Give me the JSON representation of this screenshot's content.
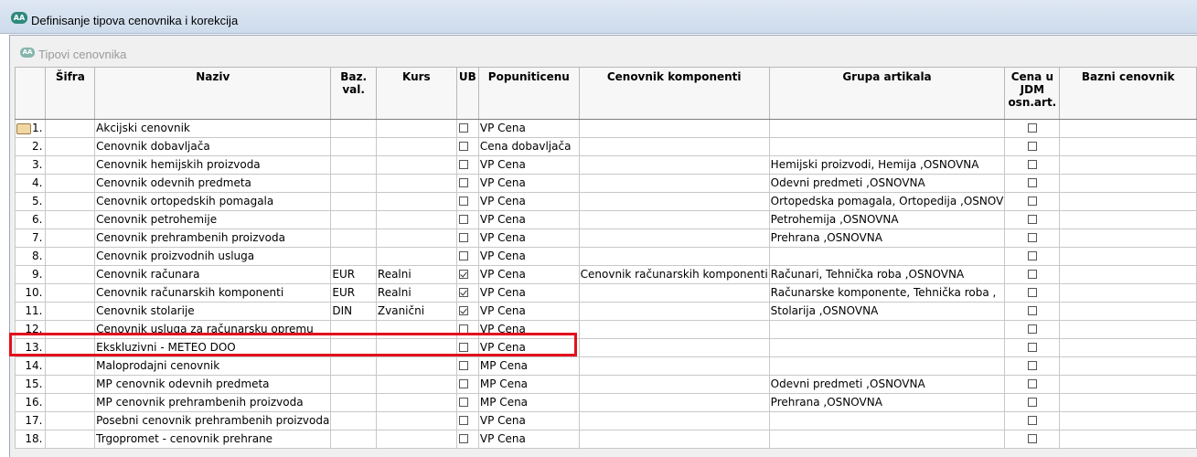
{
  "window": {
    "title": "Definisanje tipova cenovnika i korekcija",
    "icon": "app-logo-icon"
  },
  "panel": {
    "title": "Tipovi cenovnika"
  },
  "columns": {
    "sifra": "Šifra",
    "naziv": "Naziv",
    "bazval": "Baz. val.",
    "kurs": "Kurs",
    "ub": "UB",
    "popuniti": "Popuniticenu",
    "komponenti": "Cenovnik komponenti",
    "grupa": "Grupa artikala",
    "cena_jdm": "Cena u JDM osn.art.",
    "bazni": "Bazni cenovnik"
  },
  "rows": [
    {
      "num": "1.",
      "sifra": "",
      "naziv": "Akcijski cenovnik",
      "bazval": "",
      "kurs": "",
      "ub": false,
      "popuniti": "VP Cena",
      "komponenti": "",
      "grupa": "",
      "cena_jdm": false,
      "bazni": ""
    },
    {
      "num": "2.",
      "sifra": "",
      "naziv": "Cenovnik dobavljača",
      "bazval": "",
      "kurs": "",
      "ub": false,
      "popuniti": "Cena dobavljača",
      "komponenti": "",
      "grupa": "",
      "cena_jdm": false,
      "bazni": ""
    },
    {
      "num": "3.",
      "sifra": "",
      "naziv": "Cenovnik hemijskih proizvoda",
      "bazval": "",
      "kurs": "",
      "ub": false,
      "popuniti": "VP Cena",
      "komponenti": "",
      "grupa": "Hemijski proizvodi, Hemija ,OSNOVNA",
      "cena_jdm": false,
      "bazni": ""
    },
    {
      "num": "4.",
      "sifra": "",
      "naziv": "Cenovnik odevnih predmeta",
      "bazval": "",
      "kurs": "",
      "ub": false,
      "popuniti": "VP Cena",
      "komponenti": "",
      "grupa": "Odevni predmeti ,OSNOVNA",
      "cena_jdm": false,
      "bazni": ""
    },
    {
      "num": "5.",
      "sifra": "",
      "naziv": "Cenovnik ortopedskih pomagala",
      "bazval": "",
      "kurs": "",
      "ub": false,
      "popuniti": "VP Cena",
      "komponenti": "",
      "grupa": "Ortopedska pomagala, Ortopedija ,OSNOV",
      "cena_jdm": false,
      "bazni": ""
    },
    {
      "num": "6.",
      "sifra": "",
      "naziv": "Cenovnik petrohemije",
      "bazval": "",
      "kurs": "",
      "ub": false,
      "popuniti": "VP Cena",
      "komponenti": "",
      "grupa": "Petrohemija ,OSNOVNA",
      "cena_jdm": false,
      "bazni": ""
    },
    {
      "num": "7.",
      "sifra": "",
      "naziv": "Cenovnik prehrambenih proizvoda",
      "bazval": "",
      "kurs": "",
      "ub": false,
      "popuniti": "VP Cena",
      "komponenti": "",
      "grupa": "Prehrana ,OSNOVNA",
      "cena_jdm": false,
      "bazni": ""
    },
    {
      "num": "8.",
      "sifra": "",
      "naziv": "Cenovnik proizvodnih usluga",
      "bazval": "",
      "kurs": "",
      "ub": false,
      "popuniti": "VP Cena",
      "komponenti": "",
      "grupa": "",
      "cena_jdm": false,
      "bazni": ""
    },
    {
      "num": "9.",
      "sifra": "",
      "naziv": "Cenovnik računara",
      "bazval": "EUR",
      "kurs": "Realni",
      "ub": true,
      "popuniti": "VP Cena",
      "komponenti": "Cenovnik računarskih komponenti",
      "grupa": "Računari, Tehnička roba ,OSNOVNA",
      "cena_jdm": false,
      "bazni": ""
    },
    {
      "num": "10.",
      "sifra": "",
      "naziv": "Cenovnik računarskih komponenti",
      "bazval": "EUR",
      "kurs": "Realni",
      "ub": true,
      "popuniti": "VP Cena",
      "komponenti": "",
      "grupa": "Računarske komponente, Tehnička roba ,",
      "cena_jdm": false,
      "bazni": ""
    },
    {
      "num": "11.",
      "sifra": "",
      "naziv": "Cenovnik stolarije",
      "bazval": "DIN",
      "kurs": "Zvanični",
      "ub": true,
      "popuniti": "VP Cena",
      "komponenti": "",
      "grupa": "Stolarija ,OSNOVNA",
      "cena_jdm": false,
      "bazni": ""
    },
    {
      "num": "12.",
      "sifra": "",
      "naziv": "Cenovnik usluga za računarsku opremu",
      "bazval": "",
      "kurs": "",
      "ub": false,
      "popuniti": "VP Cena",
      "komponenti": "",
      "grupa": "",
      "cena_jdm": false,
      "bazni": ""
    },
    {
      "num": "13.",
      "sifra": "",
      "naziv": "Ekskluzivni - METEO DOO",
      "bazval": "",
      "kurs": "",
      "ub": false,
      "popuniti": "VP Cena",
      "komponenti": "",
      "grupa": "",
      "cena_jdm": false,
      "bazni": ""
    },
    {
      "num": "14.",
      "sifra": "",
      "naziv": "Maloprodajni cenovnik",
      "bazval": "",
      "kurs": "",
      "ub": false,
      "popuniti": "MP Cena",
      "komponenti": "",
      "grupa": "",
      "cena_jdm": false,
      "bazni": ""
    },
    {
      "num": "15.",
      "sifra": "",
      "naziv": "MP cenovnik odevnih predmeta",
      "bazval": "",
      "kurs": "",
      "ub": false,
      "popuniti": "MP Cena",
      "komponenti": "",
      "grupa": "Odevni predmeti ,OSNOVNA",
      "cena_jdm": false,
      "bazni": ""
    },
    {
      "num": "16.",
      "sifra": "",
      "naziv": "MP cenovnik prehrambenih proizvoda",
      "bazval": "",
      "kurs": "",
      "ub": false,
      "popuniti": "MP Cena",
      "komponenti": "",
      "grupa": "Prehrana ,OSNOVNA",
      "cena_jdm": false,
      "bazni": ""
    },
    {
      "num": "17.",
      "sifra": "",
      "naziv": "Posebni cenovnik prehrambenih proizvoda",
      "bazval": "",
      "kurs": "",
      "ub": false,
      "popuniti": "VP Cena",
      "komponenti": "",
      "grupa": "",
      "cena_jdm": false,
      "bazni": ""
    },
    {
      "num": "18.",
      "sifra": "",
      "naziv": "Trgopromet - cenovnik prehrane",
      "bazval": "",
      "kurs": "",
      "ub": false,
      "popuniti": "VP Cena",
      "komponenti": "",
      "grupa": "",
      "cena_jdm": false,
      "bazni": ""
    }
  ],
  "selected_row_index": 0,
  "highlighted_row_index": 12
}
